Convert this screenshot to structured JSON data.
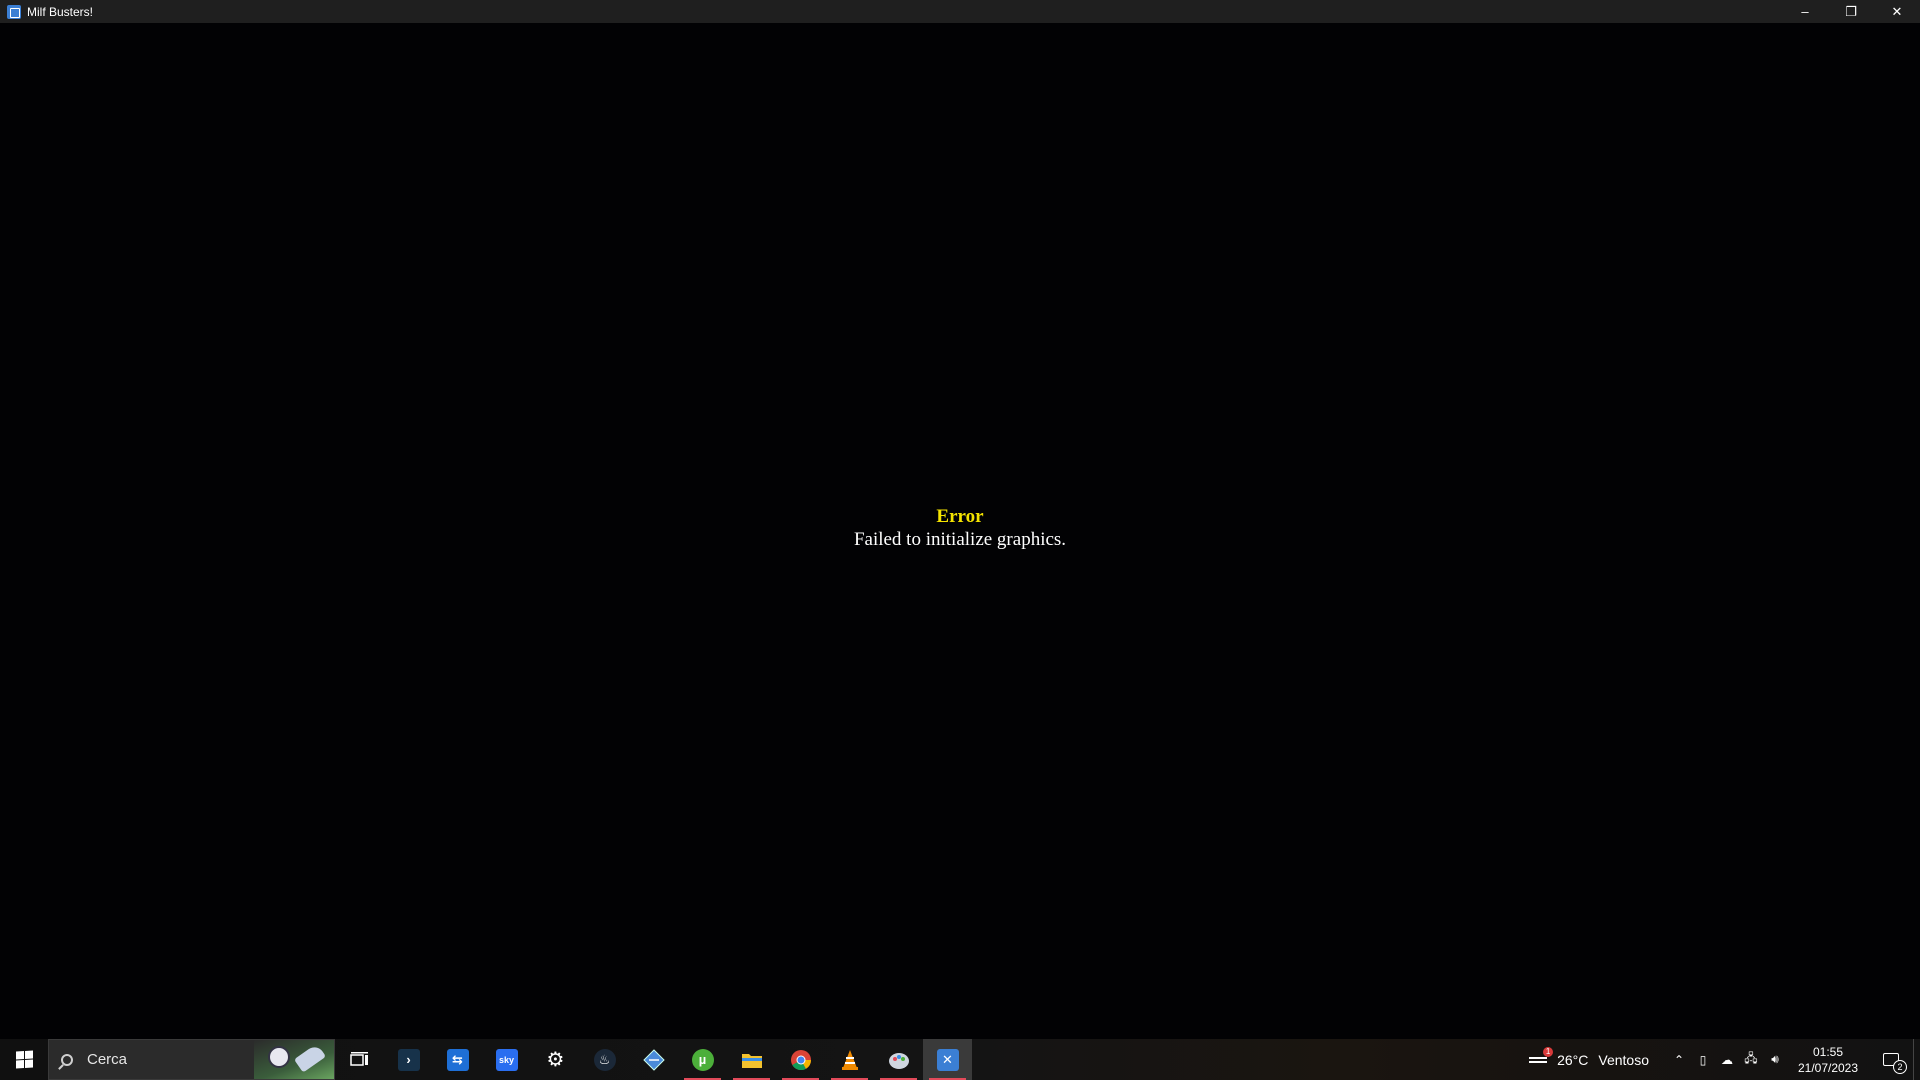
{
  "window": {
    "title": "Milf Busters!",
    "controls": {
      "minimize": "–",
      "restore": "❐",
      "close": "✕"
    }
  },
  "error": {
    "title": "Error",
    "message": "Failed to initialize graphics."
  },
  "taskbar": {
    "search": {
      "placeholder": "Cerca",
      "value": ""
    },
    "apps": [
      {
        "name": "task-view",
        "icon": "task-view-icon",
        "running": false,
        "active": false
      },
      {
        "name": "powershell",
        "icon": "terminal-icon",
        "running": false,
        "active": false
      },
      {
        "name": "remote-app",
        "icon": "remote-icon",
        "running": false,
        "active": false
      },
      {
        "name": "sky-go",
        "icon": "sky-icon",
        "running": false,
        "active": false
      },
      {
        "name": "settings",
        "icon": "gear-icon",
        "running": false,
        "active": false
      },
      {
        "name": "steam",
        "icon": "steam-icon",
        "running": false,
        "active": false
      },
      {
        "name": "app-diamond",
        "icon": "diamond-icon",
        "running": false,
        "active": false
      },
      {
        "name": "utorrent",
        "icon": "utorrent-icon",
        "running": true,
        "active": false
      },
      {
        "name": "file-explorer",
        "icon": "folder-icon",
        "running": true,
        "active": false
      },
      {
        "name": "chrome",
        "icon": "chrome-icon",
        "running": true,
        "active": false
      },
      {
        "name": "vlc",
        "icon": "vlc-icon",
        "running": true,
        "active": false
      },
      {
        "name": "paint-app",
        "icon": "palette-icon",
        "running": true,
        "active": false
      },
      {
        "name": "milf-busters",
        "icon": "game-icon",
        "running": true,
        "active": true
      }
    ],
    "weather": {
      "temperature": "26°C",
      "condition": "Ventoso",
      "badge": "1"
    },
    "clock": {
      "time": "01:55",
      "date": "21/07/2023"
    },
    "notifications": {
      "count": "2"
    }
  }
}
